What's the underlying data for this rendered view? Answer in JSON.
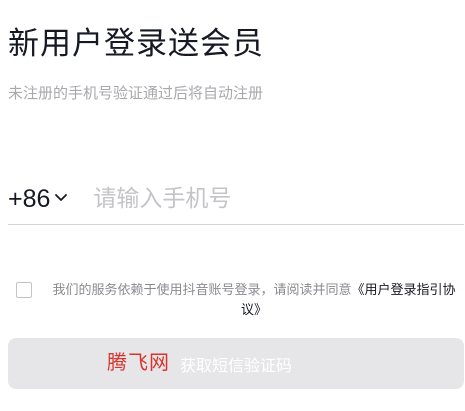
{
  "header": {
    "title": "新用户登录送会员",
    "subtitle": "未注册的手机号验证通过后将自动注册"
  },
  "phone": {
    "country_code": "+86",
    "country_code_icon": "chevron-down-icon",
    "value": "",
    "placeholder": "请输入手机号"
  },
  "agreement": {
    "checked": false,
    "text": "我们的服务依赖于使用抖音账号登录，请阅读并同意",
    "link_text": "《用户登录指引协议》"
  },
  "submit": {
    "label": "获取短信验证码",
    "enabled": false
  },
  "watermark": {
    "text": "腾飞网"
  },
  "colors": {
    "text_primary": "#161823",
    "text_secondary": "#a8a8ad",
    "placeholder": "#c4c4c8",
    "button_disabled_bg": "#e6e6e8",
    "watermark": "#d9332e"
  }
}
